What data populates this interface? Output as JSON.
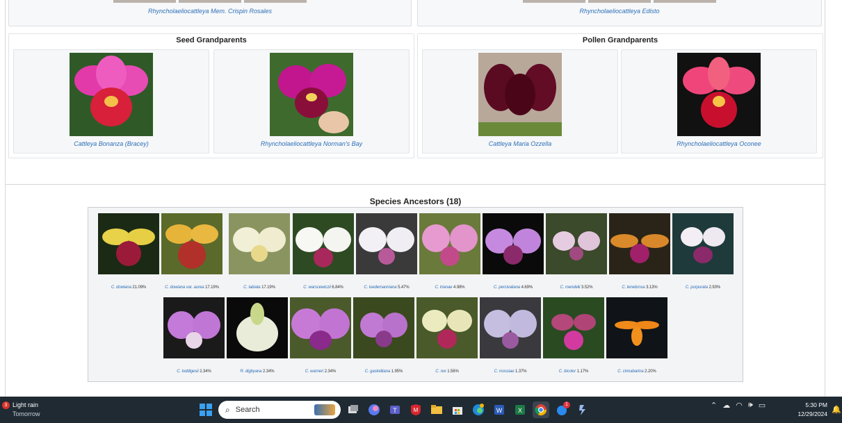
{
  "parents": [
    {
      "label": "Rhyncholaeliocattleya Mem. Crispin Rosales"
    },
    {
      "label": "Rhyncholaeliocattleya Edisto"
    }
  ],
  "seed_grandparents": {
    "title": "Seed Grandparents",
    "items": [
      {
        "label": "Cattleya Bonanza (Bracey)"
      },
      {
        "label": "Rhyncholaeliocattleya Norman's Bay"
      }
    ]
  },
  "pollen_grandparents": {
    "title": "Pollen Grandparents",
    "items": [
      {
        "label": "Cattleya Maria Ozzella"
      },
      {
        "label": "Rhyncholaeliocattleya Oconee"
      }
    ]
  },
  "species": {
    "title": "Species Ancestors (18)",
    "items": [
      {
        "name": "C. dowiana",
        "pct": "21.09%"
      },
      {
        "name": "C. dowiana var. aurea",
        "pct": "17.19%"
      },
      {
        "name": "C. labiata",
        "pct": "17.19%"
      },
      {
        "name": "C. warscewiczii",
        "pct": "6.84%"
      },
      {
        "name": "C. luedemanniana",
        "pct": "5.47%"
      },
      {
        "name": "C. trianae",
        "pct": "4.98%"
      },
      {
        "name": "C. percivaliana",
        "pct": "4.69%"
      },
      {
        "name": "C. mendelii",
        "pct": "3.52%"
      },
      {
        "name": "C. tenebrosa",
        "pct": "3.13%"
      },
      {
        "name": "C. purpurata",
        "pct": "2.93%"
      },
      {
        "name": "C. loddigesii",
        "pct": "2.34%"
      },
      {
        "name": "R. digbyana",
        "pct": "2.34%"
      },
      {
        "name": "C. warneri",
        "pct": "2.34%"
      },
      {
        "name": "C. gaskelliana",
        "pct": "1.95%"
      },
      {
        "name": "C. rex",
        "pct": "1.56%"
      },
      {
        "name": "C. mossiae",
        "pct": "1.37%"
      },
      {
        "name": "C. bicolor",
        "pct": "1.17%"
      },
      {
        "name": "C. cinnabarina",
        "pct": "2.20%"
      }
    ]
  },
  "taskbar": {
    "weather_badge": "3",
    "weather_line1": "Light rain",
    "weather_line2": "Tomorrow",
    "search_placeholder": "Search",
    "notif_badge": "1",
    "time": "5:30 PM",
    "date": "12/29/2024"
  },
  "colors": {
    "link": "#2c6fb7",
    "taskbar_bg": "#1f2a33"
  }
}
